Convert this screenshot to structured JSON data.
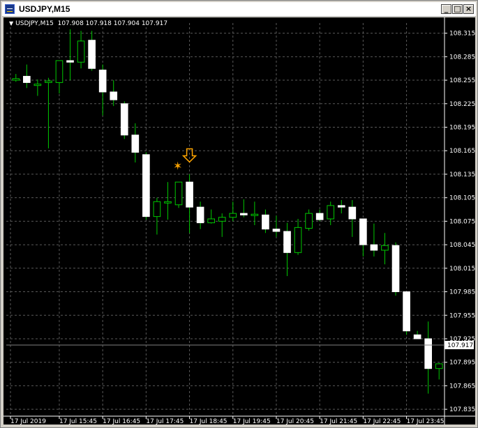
{
  "window": {
    "title": "USDJPY,M15",
    "minimize_label": "_",
    "maximize_label": "□",
    "close_label": "×"
  },
  "header": {
    "symbol": "USDJPY,M15",
    "ohlc": "107.908 107.918 107.904 107.917"
  },
  "colors": {
    "background": "#000000",
    "grid": "#5a5a5a",
    "candle": "#ffffff",
    "wick": "#00c800",
    "arrow": "#ffa500",
    "axis_text": "#ffffff",
    "price_line": "#808080"
  },
  "chart_data": {
    "type": "candlestick",
    "price_ticks": [
      "108.315",
      "108.285",
      "108.255",
      "108.225",
      "108.195",
      "108.165",
      "108.135",
      "108.105",
      "108.075",
      "108.045",
      "108.015",
      "107.985",
      "107.955",
      "107.925",
      "107.895",
      "107.865",
      "107.835"
    ],
    "time_ticks": [
      "17 Jul 2019",
      "17 Jul 15:45",
      "17 Jul 16:45",
      "17 Jul 17:45",
      "17 Jul 18:45",
      "17 Jul 19:45",
      "17 Jul 20:45",
      "17 Jul 21:45",
      "17 Jul 22:45",
      "17 Jul 23:45"
    ],
    "current_price": "107.917",
    "ylim": [
      107.828,
      108.328
    ],
    "grid": true,
    "candles": [
      {
        "o": 108.255,
        "h": 108.263,
        "l": 108.253,
        "c": 108.257
      },
      {
        "o": 108.26,
        "h": 108.275,
        "l": 108.245,
        "c": 108.252
      },
      {
        "o": 108.25,
        "h": 108.256,
        "l": 108.235,
        "c": 108.25
      },
      {
        "o": 108.252,
        "h": 108.258,
        "l": 108.168,
        "c": 108.254
      },
      {
        "o": 108.252,
        "h": 108.275,
        "l": 108.238,
        "c": 108.28
      },
      {
        "o": 108.28,
        "h": 108.32,
        "l": 108.255,
        "c": 108.278
      },
      {
        "o": 108.278,
        "h": 108.318,
        "l": 108.27,
        "c": 108.305
      },
      {
        "o": 108.306,
        "h": 108.318,
        "l": 108.267,
        "c": 108.27
      },
      {
        "o": 108.268,
        "h": 108.275,
        "l": 108.21,
        "c": 108.24
      },
      {
        "o": 108.24,
        "h": 108.255,
        "l": 108.222,
        "c": 108.23
      },
      {
        "o": 108.225,
        "h": 108.228,
        "l": 108.18,
        "c": 108.185
      },
      {
        "o": 108.185,
        "h": 108.2,
        "l": 108.15,
        "c": 108.163
      },
      {
        "o": 108.16,
        "h": 108.163,
        "l": 108.077,
        "c": 108.081
      },
      {
        "o": 108.081,
        "h": 108.105,
        "l": 108.058,
        "c": 108.1
      },
      {
        "o": 108.1,
        "h": 108.125,
        "l": 108.077,
        "c": 108.1
      },
      {
        "o": 108.096,
        "h": 108.125,
        "l": 108.092,
        "c": 108.125
      },
      {
        "o": 108.125,
        "h": 108.135,
        "l": 108.06,
        "c": 108.093
      },
      {
        "o": 108.093,
        "h": 108.1,
        "l": 108.065,
        "c": 108.073
      },
      {
        "o": 108.073,
        "h": 108.09,
        "l": 108.072,
        "c": 108.078
      },
      {
        "o": 108.075,
        "h": 108.085,
        "l": 108.055,
        "c": 108.08
      },
      {
        "o": 108.08,
        "h": 108.1,
        "l": 108.075,
        "c": 108.085
      },
      {
        "o": 108.085,
        "h": 108.103,
        "l": 108.08,
        "c": 108.083
      },
      {
        "o": 108.083,
        "h": 108.1,
        "l": 108.07,
        "c": 108.084
      },
      {
        "o": 108.083,
        "h": 108.09,
        "l": 108.06,
        "c": 108.065
      },
      {
        "o": 108.065,
        "h": 108.082,
        "l": 108.055,
        "c": 108.062
      },
      {
        "o": 108.062,
        "h": 108.073,
        "l": 108.005,
        "c": 108.035
      },
      {
        "o": 108.035,
        "h": 108.078,
        "l": 108.032,
        "c": 108.067
      },
      {
        "o": 108.066,
        "h": 108.09,
        "l": 108.063,
        "c": 108.085
      },
      {
        "o": 108.085,
        "h": 108.09,
        "l": 108.075,
        "c": 108.077
      },
      {
        "o": 108.078,
        "h": 108.1,
        "l": 108.07,
        "c": 108.095
      },
      {
        "o": 108.095,
        "h": 108.102,
        "l": 108.085,
        "c": 108.093
      },
      {
        "o": 108.093,
        "h": 108.102,
        "l": 108.055,
        "c": 108.078
      },
      {
        "o": 108.078,
        "h": 108.078,
        "l": 108.03,
        "c": 108.045
      },
      {
        "o": 108.045,
        "h": 108.072,
        "l": 108.03,
        "c": 108.038
      },
      {
        "o": 108.038,
        "h": 108.06,
        "l": 108.02,
        "c": 108.044
      },
      {
        "o": 108.044,
        "h": 108.048,
        "l": 107.98,
        "c": 107.985
      },
      {
        "o": 107.985,
        "h": 107.985,
        "l": 107.93,
        "c": 107.935
      },
      {
        "o": 107.93,
        "h": 107.935,
        "l": 107.925,
        "c": 107.925
      },
      {
        "o": 107.925,
        "h": 107.947,
        "l": 107.855,
        "c": 107.887
      },
      {
        "o": 107.887,
        "h": 107.894,
        "l": 107.873,
        "c": 107.893
      }
    ],
    "markers": [
      {
        "type": "down-arrow",
        "candle": 16,
        "price": 108.155
      },
      {
        "type": "star",
        "candle": 15,
        "price": 108.145
      }
    ]
  }
}
